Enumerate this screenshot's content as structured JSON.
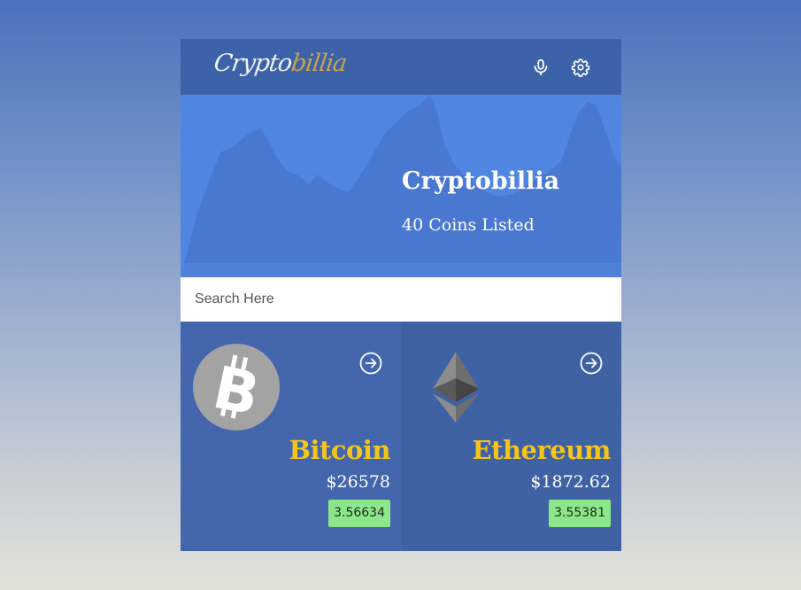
{
  "header": {
    "logo_main": "Crypto",
    "logo_accent": "billia",
    "mic_icon": "microphone-icon",
    "settings_icon": "gear-icon"
  },
  "hero": {
    "title": "Cryptobillia",
    "subtitle": "40 Coins Listed"
  },
  "search": {
    "placeholder": "Search Here",
    "value": ""
  },
  "coins": [
    {
      "name": "Bitcoin",
      "price": "$26578",
      "change": "3.56634",
      "icon": "bitcoin-icon"
    },
    {
      "name": "Ethereum",
      "price": "$1872.62",
      "change": "3.55381",
      "icon": "ethereum-icon"
    }
  ],
  "colors": {
    "header_bg": "#3c62a9",
    "hero_bg": "#5086e2",
    "coin_name": "#f5c518",
    "badge_bg": "#8ce68a"
  }
}
